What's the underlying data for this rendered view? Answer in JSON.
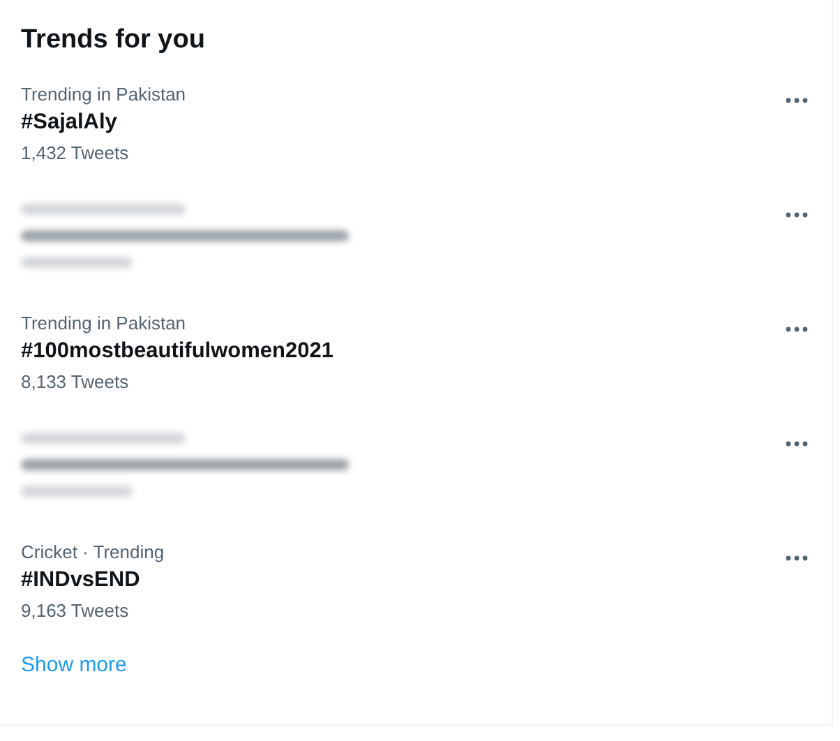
{
  "panel": {
    "title": "Trends for you",
    "trends": [
      {
        "blurred": false,
        "context": "Trending in Pakistan",
        "name": "#SajalAly",
        "count": "1,432 Tweets"
      },
      {
        "blurred": true
      },
      {
        "blurred": false,
        "context": "Trending in Pakistan",
        "name": "#100mostbeautifulwomen2021",
        "count": "8,133 Tweets"
      },
      {
        "blurred": true
      },
      {
        "blurred": false,
        "context": "Cricket · Trending",
        "name": "#INDvsEND",
        "count": "9,163 Tweets"
      }
    ],
    "show_more": "Show more"
  }
}
